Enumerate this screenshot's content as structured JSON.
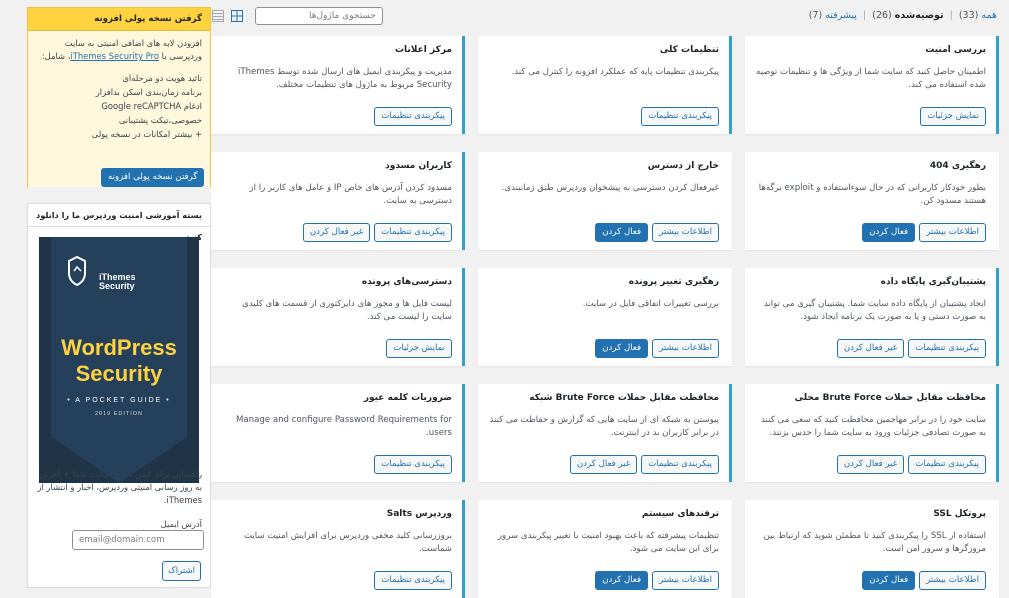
{
  "filters": {
    "all_label": "همه",
    "all_count": "(33)",
    "recommended_label": "توصیه‌شده",
    "recommended_count": "(26)",
    "advanced_label": "پیشرفته",
    "advanced_count": "(7)",
    "separator": "|"
  },
  "search": {
    "placeholder": "جستجوی ماژول‌ها"
  },
  "view_icons": {
    "grid": "grid-view-icon",
    "list": "list-view-icon"
  },
  "colors": {
    "accent": "#2271b1",
    "active_border": "#2ea2cc",
    "promo_head": "#ffd23f",
    "promo_body": "#fff8dc",
    "book_bg": "#1f3547",
    "book_title": "#ffd23f"
  },
  "modules": [
    {
      "title": "بررسی امنیت",
      "desc": "اطمینان حاصل کنید که سایت شما از ویژگی ها و تنظیمات توصیه شده استفاده می کند.",
      "buttons": [
        "نمایش جزئیات"
      ],
      "active": true
    },
    {
      "title": "تنظیمات کلی",
      "desc": "پیکربندی تنظیمات پایه که عملکرد افزونه را کنترل می کند.",
      "buttons": [
        "پیکربندی تنظیمات"
      ],
      "active": true
    },
    {
      "title": "مرکز اعلانات",
      "desc": "مدیریت و پیکربندی ایمیل های ارسال شده توسط iThemes Security مربوط به ماژول های تنظیمات مختلف.",
      "buttons": [
        "پیکربندی تنظیمات"
      ],
      "active": true
    },
    {
      "title": "رهگیری 404",
      "desc": "بطور خودکار کاربرانی که در حال سوءاستفاده و exploit برگه‌ها هستند مسدود کن.",
      "buttons": [
        "اطلاعات بیشتر",
        "فعال کردن"
      ],
      "active": false
    },
    {
      "title": "خارج از دسترس",
      "desc": "غیرفعال کردن دسترسی به پیشخوان وردپرس طبق زمانبندی.",
      "buttons": [
        "اطلاعات بیشتر",
        "فعال کردن"
      ],
      "active": false
    },
    {
      "title": "کاربران مسدود",
      "desc": "مسدود کردن آدرس های خاص IP و عامل های کاربر را از دسترسی به سایت.",
      "buttons": [
        "پیکربندی تنظیمات",
        "غیر فعال کردن"
      ],
      "active": true
    },
    {
      "title": "پشتیبان‌گیری پایگاه داده",
      "desc": "ایجاد پشتیبان از پایگاه داده سایت شما. پشتیبان گیری می تواند به صورت دستی و یا به صورت یک برنامه ایجاد شود.",
      "buttons": [
        "پیکربندی تنظیمات",
        "غیر فعال کردن"
      ],
      "active": true
    },
    {
      "title": "رهگیری تغییر پرونده",
      "desc": "بررسی تغییرات اتفاقی فایل در سایت.",
      "buttons": [
        "اطلاعات بیشتر",
        "فعال کردن"
      ],
      "active": false
    },
    {
      "title": "دسترسی‌های پرونده",
      "desc": "لیست فایل ها و مجوز های دایرکتوری از قسمت های کلیدی سایت را لیست می کند.",
      "buttons": [
        "نمایش جزئیات"
      ],
      "active": true
    },
    {
      "title": "محافظت مقابل حملات Brute Force محلی",
      "desc": "سایت خود را در برابر مهاجمین محافظت کنید که سعی می کنند به صورت تصادفی جزئیات ورود به سایت شما را حدس بزنند.",
      "buttons": [
        "پیکربندی تنظیمات",
        "غیر فعال کردن"
      ],
      "active": true
    },
    {
      "title": "محافظت مقابل حملات Brute Force شبکه",
      "desc": "پیوستن به شبکه ای از سایت هایی که گزارش و حفاظت می کنند در برابر کاربران بد در اینترنت.",
      "buttons": [
        "پیکربندی تنظیمات",
        "غیر فعال کردن"
      ],
      "active": true
    },
    {
      "title": "ضروریات کلمه عبور",
      "desc": "Manage and configure Password Requirements for users.",
      "buttons": [
        "پیکربندی تنظیمات"
      ],
      "active": true
    },
    {
      "title": "پروتکل SSL",
      "desc": "استفاده از SSL را پیکربندی کنید تا مطمئن شوید که ارتباط بین مرورگرها و سرور امن است.",
      "buttons": [
        "اطلاعات بیشتر",
        "فعال کردن"
      ],
      "active": false
    },
    {
      "title": "ترفندهای سیستم",
      "desc": "تنظیمات پیشرفته که باعث بهبود امنیت با تغییر پیکربندی سرور برای این سایت می شود.",
      "buttons": [
        "اطلاعات بیشتر",
        "فعال کردن"
      ],
      "active": false
    },
    {
      "title": "وردپرس Salts",
      "desc": "بروزرسانی کلید مخفی وردپرس برای افزایش امنیت سایت شماست.",
      "buttons": [
        "پیکربندی تنظیمات"
      ],
      "active": true
    }
  ],
  "pro_box": {
    "title": "گرفتن نسخه پولی افزونه",
    "intro_before": "افزودن لایه های اضافی امنیتی به سایت وردپرسی با",
    "intro_link": "iThemes Security Pro",
    "intro_after": "، شامل:",
    "features": [
      "تائید هویت دو مرحله‌ای",
      "برنامه زمان‌بندی اسکن بدافزار",
      "ادغام Google reCAPTCHA",
      "خصوصی،تیکت پشتیبانی",
      "+ بیشتر امکانات در نسخه پولی"
    ],
    "button": "گرفتن نسخه پولی افزونه"
  },
  "guide_box": {
    "title": "بسته آموزشی امنیت وردپرس ما را دانلود کنید",
    "book_brand_1": "iThemes",
    "book_brand_2": "Security",
    "book_title_1": "WordPress",
    "book_title_2": "Security",
    "book_subtitle": "• A POCKET GUIDE •",
    "book_edition": "2019 EDITION",
    "description": "راهنمایی برای ایمن سازی سایت شما + آخرین به روز رسانی امنیتی وردپرس، اخبار و انتشار از iThemes.",
    "email_label": "آدرس ایمیل",
    "email_placeholder": "email@domain.com",
    "subscribe": "اشتراک"
  }
}
